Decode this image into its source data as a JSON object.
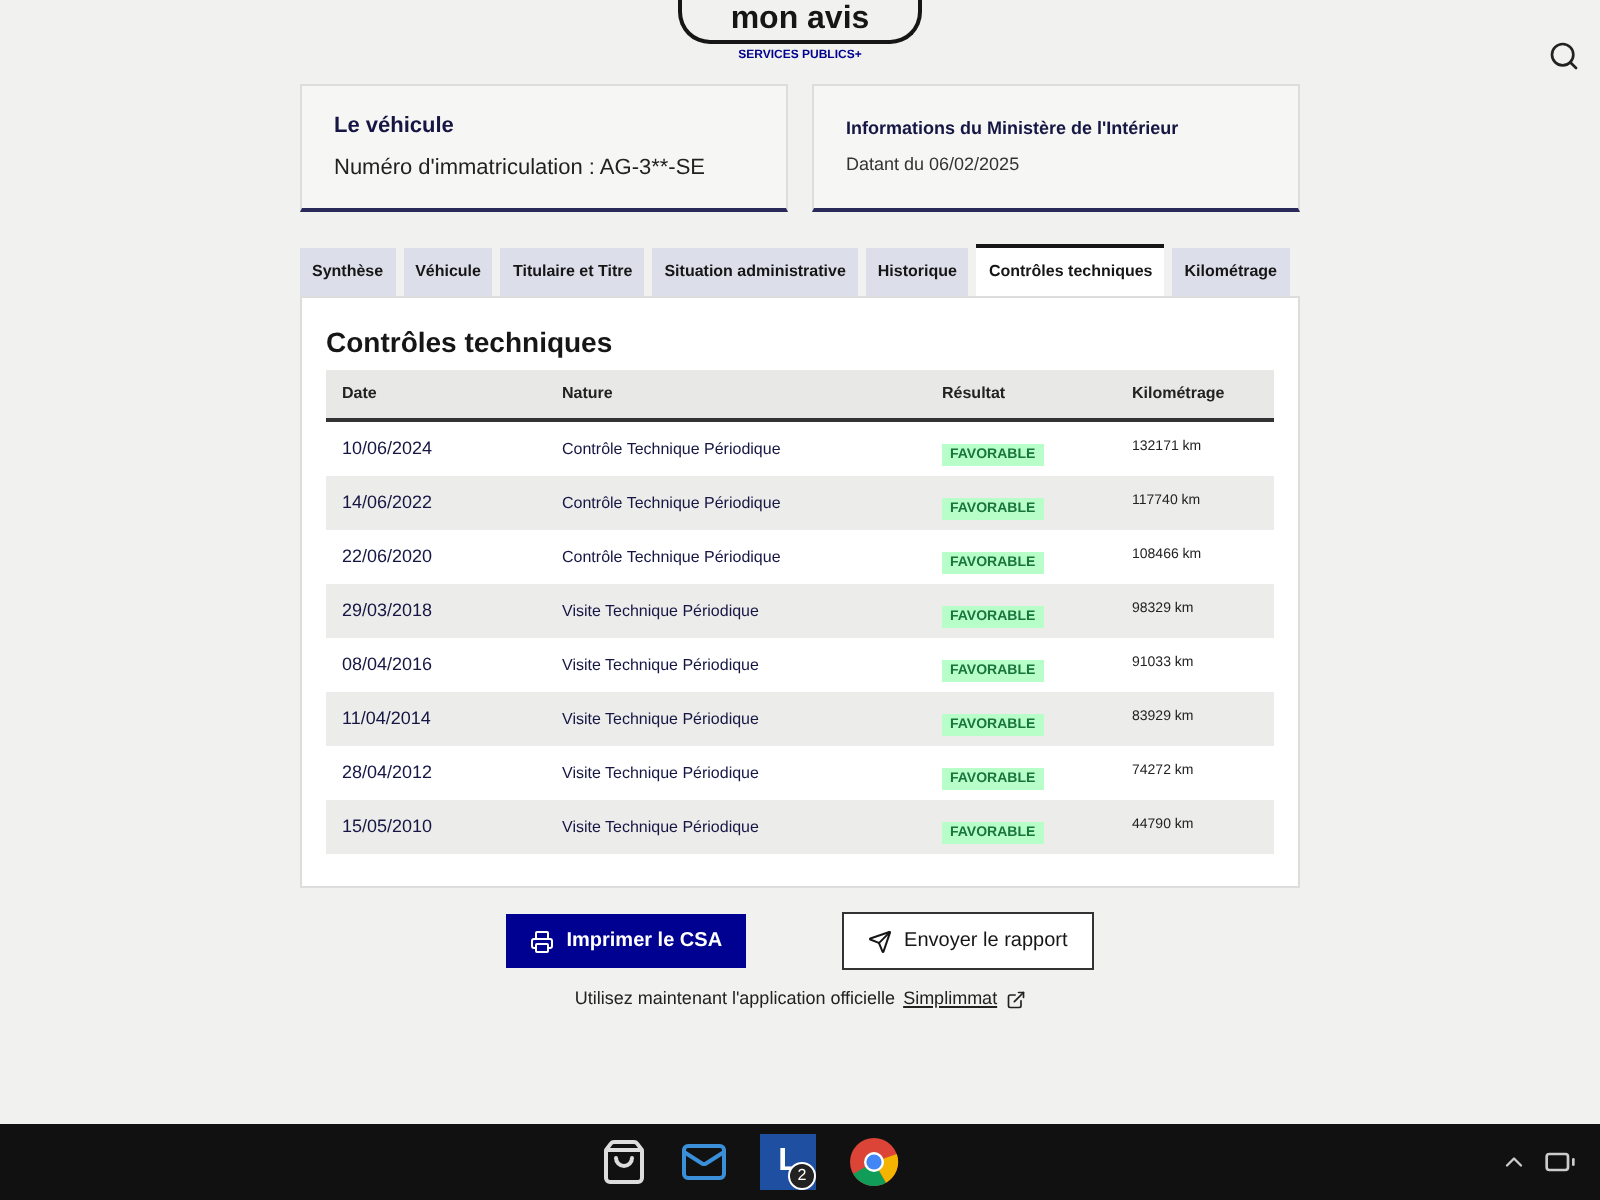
{
  "header": {
    "feedback_button": "mon avis",
    "logo_text": "SERVICES PUBLICS+"
  },
  "vehicle_card": {
    "title": "Le véhicule",
    "text": "Numéro d'immatriculation : AG-3**-SE"
  },
  "source_card": {
    "title": "Informations du Ministère de l'Intérieur",
    "text": "Datant du 06/02/2025"
  },
  "tabs": [
    {
      "label": "Synthèse",
      "selected": false
    },
    {
      "label": "Véhicule",
      "selected": false
    },
    {
      "label": "Titulaire et Titre",
      "selected": false
    },
    {
      "label": "Situation administrative",
      "selected": false
    },
    {
      "label": "Historique",
      "selected": false
    },
    {
      "label": "Contrôles techniques",
      "selected": true
    },
    {
      "label": "Kilométrage",
      "selected": false
    }
  ],
  "section_title": "Contrôles techniques",
  "table": {
    "columns": [
      "Date",
      "Nature",
      "Résultat",
      "Kilométrage"
    ],
    "rows": [
      {
        "date": "10/06/2024",
        "nature": "Contrôle Technique Périodique",
        "result": "FAVORABLE",
        "mileage": "132171 km"
      },
      {
        "date": "14/06/2022",
        "nature": "Contrôle Technique Périodique",
        "result": "FAVORABLE",
        "mileage": "117740 km"
      },
      {
        "date": "22/06/2020",
        "nature": "Contrôle Technique Périodique",
        "result": "FAVORABLE",
        "mileage": "108466 km"
      },
      {
        "date": "29/03/2018",
        "nature": "Visite Technique Périodique",
        "result": "FAVORABLE",
        "mileage": "98329 km"
      },
      {
        "date": "08/04/2016",
        "nature": "Visite Technique Périodique",
        "result": "FAVORABLE",
        "mileage": "91033 km"
      },
      {
        "date": "11/04/2014",
        "nature": "Visite Technique Périodique",
        "result": "FAVORABLE",
        "mileage": "83929 km"
      },
      {
        "date": "28/04/2012",
        "nature": "Visite Technique Périodique",
        "result": "FAVORABLE",
        "mileage": "74272 km"
      },
      {
        "date": "15/05/2010",
        "nature": "Visite Technique Périodique",
        "result": "FAVORABLE",
        "mileage": "44790 km"
      }
    ]
  },
  "actions": {
    "print_button": "Imprimer le CSA",
    "send_button": "Envoyer le rapport"
  },
  "footer": {
    "text": "Utilisez maintenant l'application officielle",
    "link": "Simplimmat"
  },
  "taskbar": {
    "app_badge": "2",
    "app_letter": "L"
  }
}
